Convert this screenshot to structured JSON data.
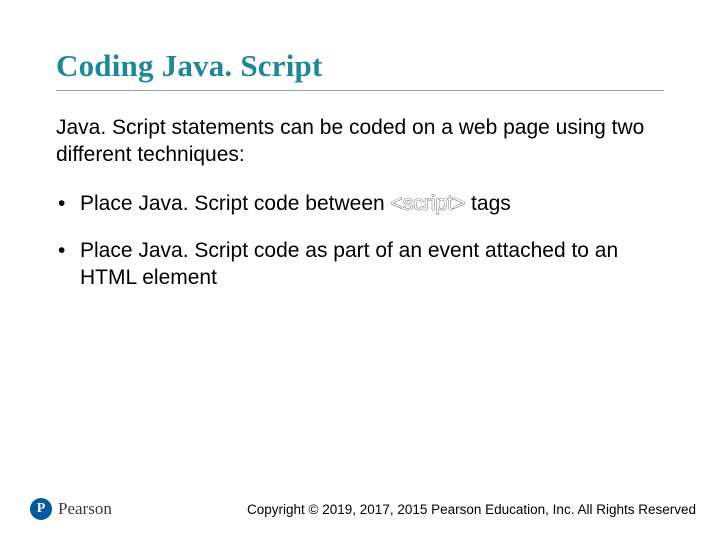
{
  "title": "Coding Java. Script",
  "lead": "Java. Script statements can be coded on a web page using two different techniques:",
  "bullets": [
    {
      "pre": "Place Java. Script code between ",
      "code": "<script>",
      "post": " tags"
    },
    {
      "text": "Place Java. Script code as part of an event attached to an HTML element"
    }
  ],
  "footer": {
    "logo_initial": "P",
    "logo_text": "Pearson",
    "copyright": "Copyright © 2019, 2017, 2015 Pearson Education, Inc. All Rights Reserved"
  }
}
